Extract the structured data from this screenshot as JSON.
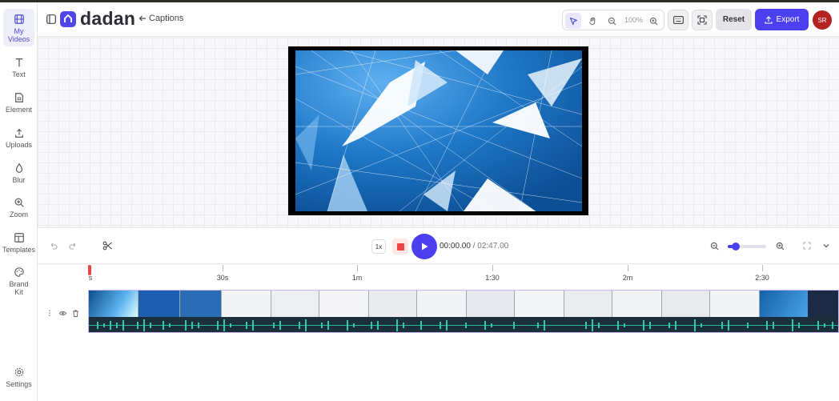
{
  "sidebar": {
    "items": [
      {
        "label": "My Videos",
        "icon": "film-icon"
      },
      {
        "label": "Text",
        "icon": "text-icon"
      },
      {
        "label": "Element",
        "icon": "element-icon"
      },
      {
        "label": "Uploads",
        "icon": "upload-icon"
      },
      {
        "label": "Blur",
        "icon": "blur-icon"
      },
      {
        "label": "Zoom",
        "icon": "zoom-icon"
      },
      {
        "label": "Templates",
        "icon": "templates-icon"
      },
      {
        "label": "Brand Kit",
        "icon": "palette-icon"
      }
    ],
    "settings_label": "Settings"
  },
  "header": {
    "logo_text": "dadan",
    "back_label": "Captions",
    "zoom_level": "100%",
    "reset_label": "Reset",
    "export_label": "Export",
    "avatar_initials": "SR"
  },
  "player": {
    "speed": "1x",
    "current_time": "00:00.00",
    "separator": " / ",
    "duration": "02:47.00",
    "zoom_slider_level": 0.2
  },
  "timeline": {
    "ruler_labels": [
      "s",
      "30s",
      "1m",
      "1:30",
      "2m",
      "2:30"
    ]
  },
  "colors": {
    "accent": "#4b3ff0",
    "avatar_bg": "#b52222",
    "stop": "#ef4444"
  }
}
